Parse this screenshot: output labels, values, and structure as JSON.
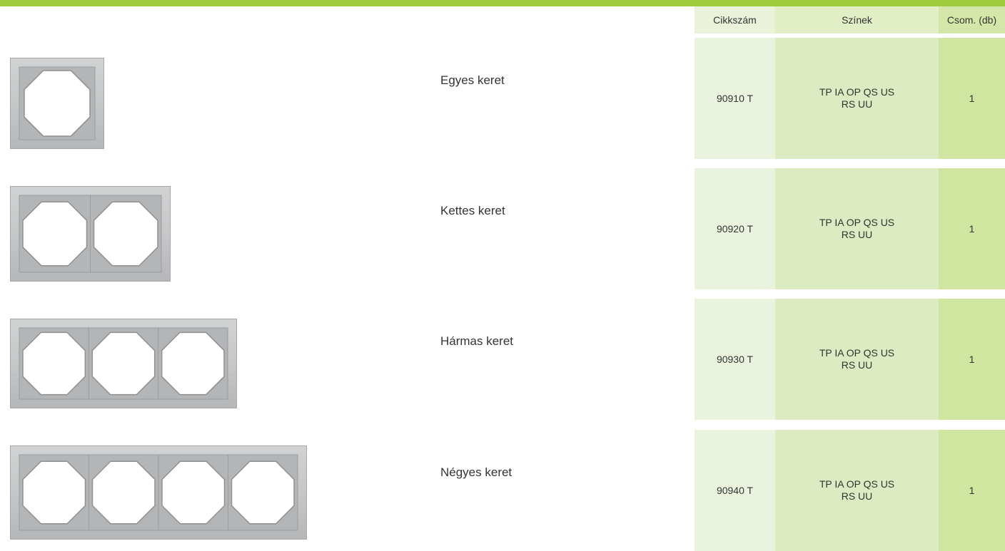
{
  "colors": {
    "top_bar": "#9ecb3c",
    "header_col1": "#eaf3da",
    "header_col2": "#e1eec6",
    "header_col3": "#d5e7a8",
    "cell_col1": "#e9f3dd",
    "cell_col2": "#dcebc1",
    "cell_col3": "#d0e59f",
    "frame_light": "#c5c7c8",
    "frame_dark": "#a4a6a8"
  },
  "table": {
    "columns": [
      "Cikkszám",
      "Színek",
      "Csom. (db)"
    ]
  },
  "products": [
    {
      "name": "Egyes keret",
      "sku": "90910 T",
      "colors_line1": "TP IA OP QS US",
      "colors_line2": "RS UU",
      "qty": "1",
      "gangs": 1
    },
    {
      "name": "Kettes keret",
      "sku": "90920 T",
      "colors_line1": "TP IA OP QS US",
      "colors_line2": "RS UU",
      "qty": "1",
      "gangs": 2
    },
    {
      "name": "Hármas keret",
      "sku": "90930 T",
      "colors_line1": "TP IA OP QS US",
      "colors_line2": "RS UU",
      "qty": "1",
      "gangs": 3
    },
    {
      "name": "Négyes keret",
      "sku": "90940 T",
      "colors_line1": "TP IA OP QS US",
      "colors_line2": "RS UU",
      "qty": "1",
      "gangs": 4
    }
  ]
}
